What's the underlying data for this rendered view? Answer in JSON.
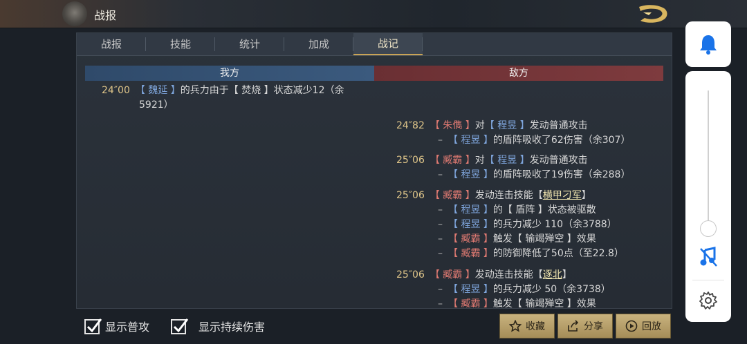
{
  "header": {
    "title": "战报"
  },
  "tabs": [
    {
      "label": "战报"
    },
    {
      "label": "技能"
    },
    {
      "label": "统计"
    },
    {
      "label": "加成"
    },
    {
      "label": "战记",
      "active": true
    }
  ],
  "log": {
    "ours_label": "我方",
    "theirs_label": "敌方",
    "ours_entries": [
      {
        "time": "24″00",
        "actor": "【 魏延 】",
        "text": "的兵力由于【 焚烧 】状态减少12（余",
        "cont": "5921）"
      }
    ],
    "theirs_entries": [
      {
        "time": "24″82",
        "actor": "【 朱儁 】",
        "mid": "对",
        "target": "【 程昱 】",
        "text": "发动普通攻击",
        "subs": [
          {
            "actor": "【 程昱 】",
            "text": "的盾阵吸收了62伤害（余307）"
          }
        ]
      },
      {
        "time": "25″06",
        "actor": "【 臧霸 】",
        "mid": "对",
        "target": "【 程昱 】",
        "text": "发动普通攻击",
        "subs": [
          {
            "actor": "【 程昱 】",
            "text": "的盾阵吸收了19伤害（余288）"
          }
        ]
      },
      {
        "time": "25″06",
        "actor": "【 臧霸 】",
        "text": "发动连击技能【",
        "skill": "横甲刁军",
        "close": "】",
        "subs": [
          {
            "actor": "【 程昱 】",
            "text": "的【 盾阵 】状态被驱散"
          },
          {
            "actor": "【 程昱 】",
            "text": "的兵力减少 110（余3788）"
          },
          {
            "actor": "【 臧霸 】",
            "text": "触发【 输竭殚空 】效果"
          },
          {
            "actor": "【 臧霸 】",
            "text": "的防御降低了50点（至22.8）"
          }
        ]
      },
      {
        "time": "25″06",
        "actor": "【 臧霸 】",
        "text": "发动连击技能【",
        "skill": "逐北",
        "close": "】",
        "subs": [
          {
            "actor": "【 程昱 】",
            "text": "的兵力减少 50（余3738）"
          },
          {
            "actor": "【 臧霸 】",
            "text": "触发【 输竭殚空 】效果"
          }
        ]
      }
    ]
  },
  "options": {
    "show_normal_attack": "显示普攻",
    "show_dot": "显示持续伤害"
  },
  "buttons": {
    "favorite": "收藏",
    "share": "分享",
    "replay": "回放"
  },
  "colors": {
    "ally_blue": "#7fa6dd",
    "enemy_red": "#e07a72",
    "time_gold": "#e0c68a",
    "button_gold": "#c8b27e"
  },
  "icons": [
    "dragon-logo-icon",
    "bell-icon",
    "music-off-icon",
    "gear-icon",
    "star-icon",
    "share-icon",
    "play-icon",
    "check-icon"
  ]
}
